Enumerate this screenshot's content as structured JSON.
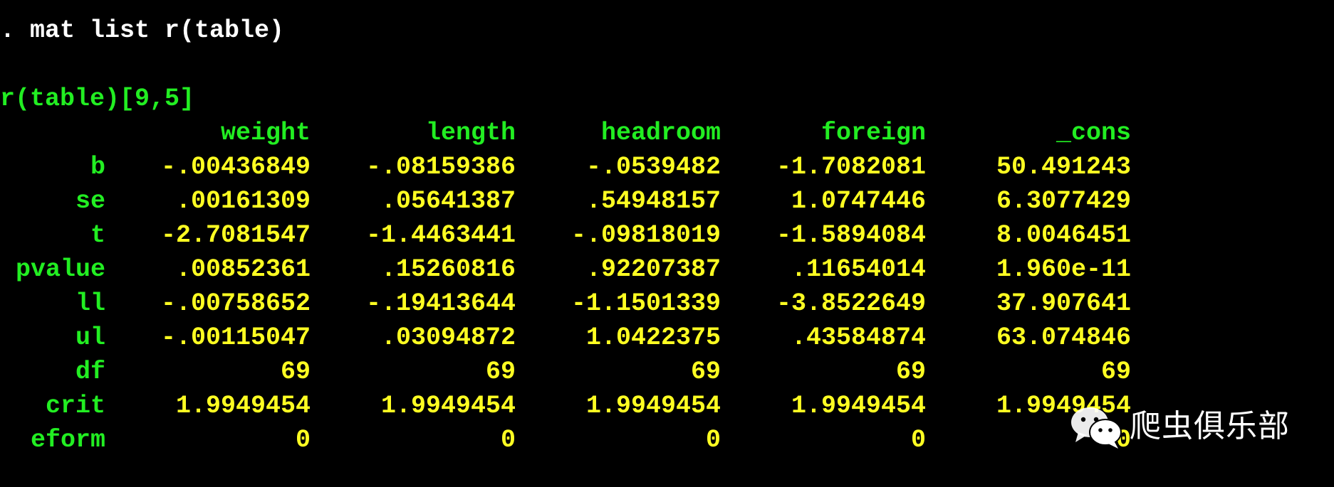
{
  "console": {
    "command": ". mat list r(table)",
    "matrix_title": "r(table)[9,5]",
    "columns": [
      "weight",
      "length",
      "headroom",
      "foreign",
      "_cons"
    ],
    "rows": [
      {
        "name": "b",
        "values": [
          "-.00436849",
          "-.08159386",
          "-.0539482",
          "-1.7082081",
          "50.491243"
        ]
      },
      {
        "name": "se",
        "values": [
          ".00161309",
          ".05641387",
          ".54948157",
          "1.0747446",
          "6.3077429"
        ]
      },
      {
        "name": "t",
        "values": [
          "-2.7081547",
          "-1.4463441",
          "-.09818019",
          "-1.5894084",
          "8.0046451"
        ]
      },
      {
        "name": "pvalue",
        "values": [
          ".00852361",
          ".15260816",
          ".92207387",
          ".11654014",
          "1.960e-11"
        ]
      },
      {
        "name": "ll",
        "values": [
          "-.00758652",
          "-.19413644",
          "-1.1501339",
          "-3.8522649",
          "37.907641"
        ]
      },
      {
        "name": "ul",
        "values": [
          "-.00115047",
          ".03094872",
          "1.0422375",
          ".43584874",
          "63.074846"
        ]
      },
      {
        "name": "df",
        "values": [
          "69",
          "69",
          "69",
          "69",
          "69"
        ]
      },
      {
        "name": "crit",
        "values": [
          "1.9949454",
          "1.9949454",
          "1.9949454",
          "1.9949454",
          "1.9949454"
        ]
      },
      {
        "name": "eform",
        "values": [
          "0",
          "0",
          "0",
          "0",
          "0"
        ]
      }
    ]
  },
  "watermark": {
    "icon": "wechat-icon",
    "text": "爬虫俱乐部"
  },
  "colors": {
    "background": "#000000",
    "command": "#ffffff",
    "labels": "#22ee22",
    "values": "#ffff22"
  }
}
